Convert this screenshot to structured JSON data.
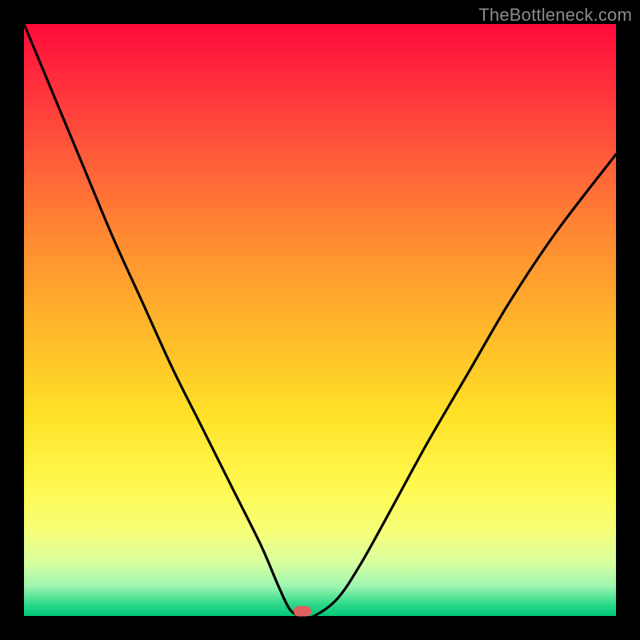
{
  "watermark": "TheBottleneck.com",
  "chart_data": {
    "type": "line",
    "title": "",
    "xlabel": "",
    "ylabel": "",
    "x_range": [
      0,
      100
    ],
    "y_range": [
      0,
      100
    ],
    "background_gradient": {
      "top_color": "#ff0a3a",
      "mid_color": "#ffe127",
      "bottom_color": "#00c777"
    },
    "series": [
      {
        "name": "bottleneck-curve",
        "x": [
          0,
          5,
          10,
          15,
          20,
          25,
          30,
          35,
          40,
          43,
          45,
          47,
          49,
          53,
          57,
          62,
          68,
          75,
          82,
          90,
          100
        ],
        "y": [
          100,
          88,
          76,
          64,
          53,
          42,
          32,
          22,
          12,
          5,
          1,
          0,
          0,
          3,
          9,
          18,
          29,
          41,
          53,
          65,
          78
        ]
      }
    ],
    "highlight_point": {
      "x": 47,
      "y": 0,
      "color": "#e06060"
    },
    "annotations": []
  }
}
